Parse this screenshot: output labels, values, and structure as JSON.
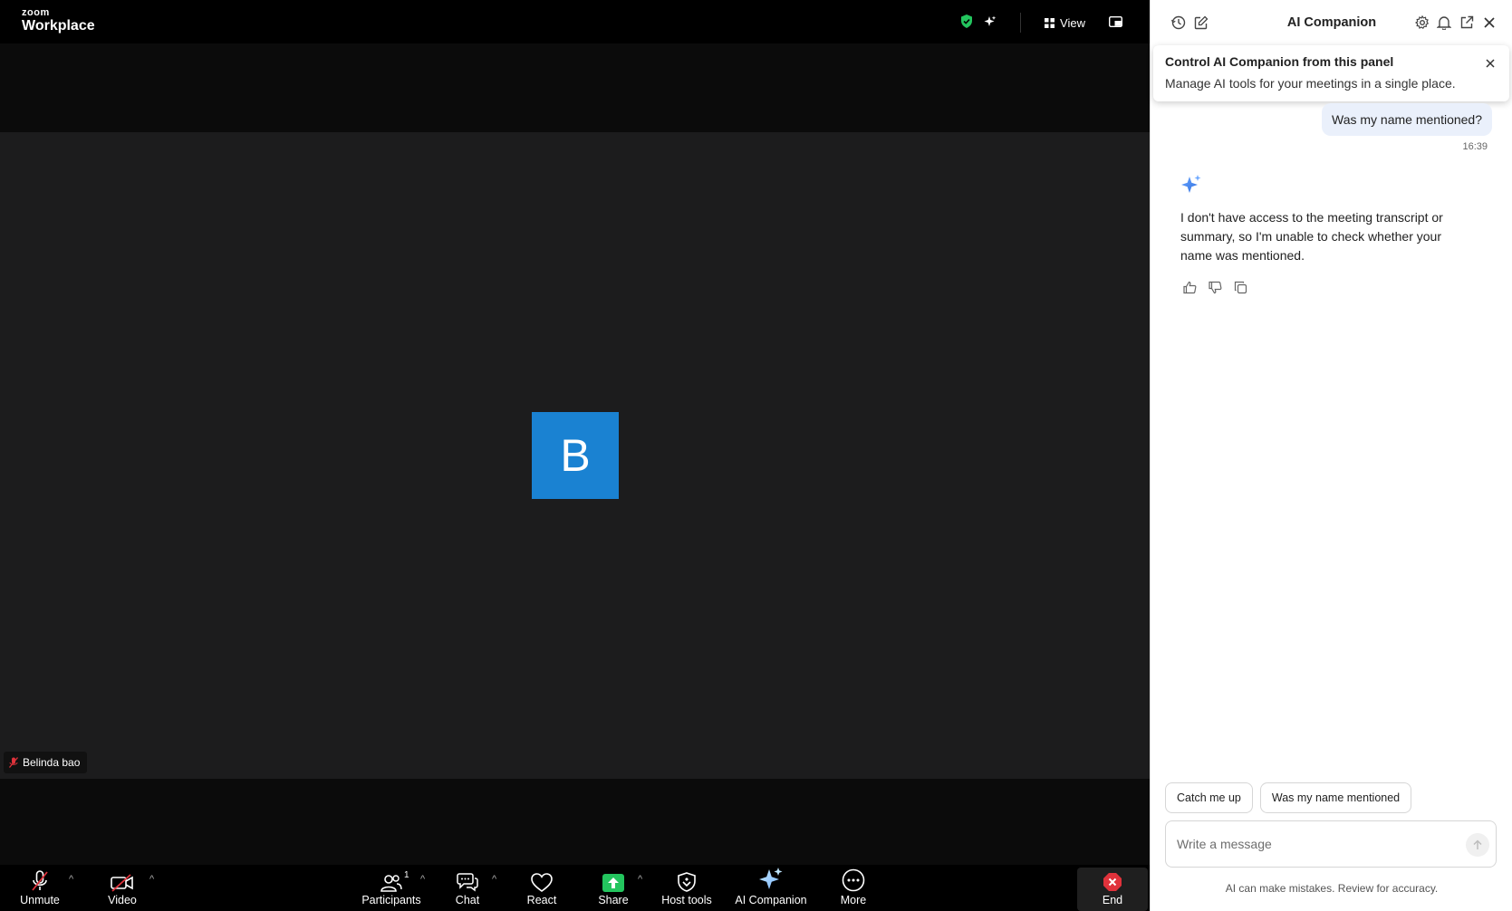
{
  "app": {
    "logo_small": "zoom",
    "logo_big": "Workplace",
    "view_label": "View"
  },
  "stage": {
    "avatar_letter": "B",
    "participant_name": "Belinda bao"
  },
  "toolbar": {
    "unmute": "Unmute",
    "video": "Video",
    "participants": "Participants",
    "participants_count": "1",
    "chat": "Chat",
    "react": "React",
    "share": "Share",
    "host_tools": "Host tools",
    "ai_companion": "AI Companion",
    "more": "More",
    "end": "End"
  },
  "panel": {
    "title": "AI Companion",
    "tip": {
      "title": "Control AI Companion from this panel",
      "body": "Manage AI tools for your meetings in a single place."
    },
    "messages": {
      "user_text": "Was my name mentioned?",
      "user_time": "16:39",
      "ai_text": "I don't have access to the meeting transcript or summary, so I'm unable to check whether your name was mentioned."
    },
    "chips": [
      "Catch me up",
      "Was my name mentioned"
    ],
    "composer_placeholder": "Write a message",
    "disclaimer": "AI can make mistakes. Review for accuracy."
  },
  "colors": {
    "avatar_bg": "#1a82d2",
    "share_green": "#23c55e",
    "end_red": "#e0323b",
    "ai_blue": "#2f6fe0"
  }
}
